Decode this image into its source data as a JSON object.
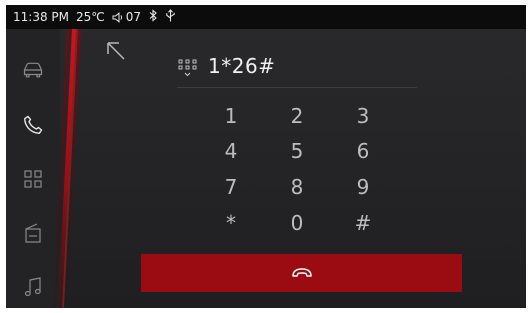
{
  "status": {
    "time": "11:38 PM",
    "temperature": "25℃",
    "volume": "07",
    "icons": [
      "volume-icon",
      "bluetooth-icon",
      "usb-icon"
    ]
  },
  "sidebar": {
    "items": [
      {
        "icon": "car-icon"
      },
      {
        "icon": "phone-icon",
        "active": true
      },
      {
        "icon": "apps-grid-icon"
      },
      {
        "icon": "radio-icon"
      },
      {
        "icon": "music-note-icon"
      }
    ]
  },
  "dialer": {
    "number": "1*26#",
    "keys": [
      "1",
      "2",
      "3",
      "4",
      "5",
      "6",
      "7",
      "8",
      "9",
      "*",
      "0",
      "#"
    ],
    "call_bar_icon": "hang-up-icon"
  },
  "colors": {
    "accent_red": "#9b0b12",
    "background": "#1d1d1f",
    "statusbar": "#0c0c0d"
  }
}
